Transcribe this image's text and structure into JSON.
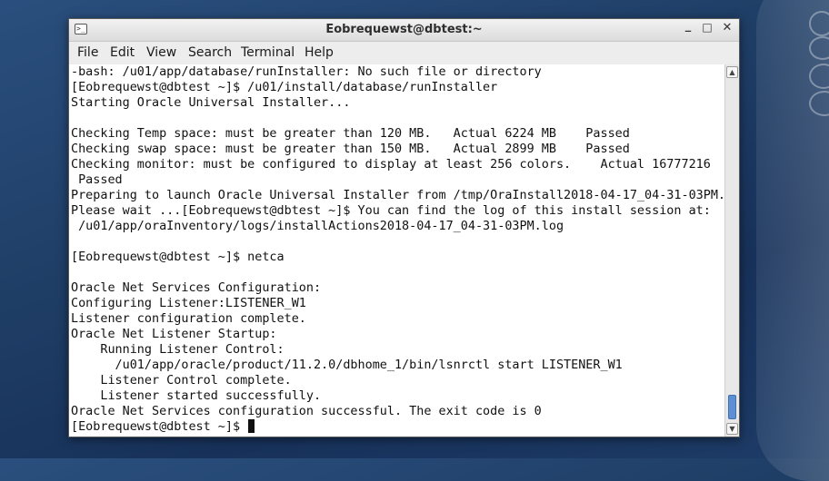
{
  "window": {
    "title": "Eobrequewst@dbtest:~",
    "minimize_glyph": "_",
    "maximize_glyph": "□",
    "close_glyph": "✕"
  },
  "menu": {
    "file": "File",
    "edit": "Edit",
    "view": "View",
    "search": "Search",
    "terminal": "Terminal",
    "help": "Help"
  },
  "terminal": {
    "lines": [
      "-bash: /u01/app/database/runInstaller: No such file or directory",
      "[Eobrequewst@dbtest ~]$ /u01/install/database/runInstaller",
      "Starting Oracle Universal Installer...",
      "",
      "Checking Temp space: must be greater than 120 MB.   Actual 6224 MB    Passed",
      "Checking swap space: must be greater than 150 MB.   Actual 2899 MB    Passed",
      "Checking monitor: must be configured to display at least 256 colors.    Actual 16777216",
      " Passed",
      "Preparing to launch Oracle Universal Installer from /tmp/OraInstall2018-04-17_04-31-03PM.",
      "Please wait ...[Eobrequewst@dbtest ~]$ You can find the log of this install session at:",
      " /u01/app/oraInventory/logs/installActions2018-04-17_04-31-03PM.log",
      "",
      "[Eobrequewst@dbtest ~]$ netca",
      "",
      "Oracle Net Services Configuration:",
      "Configuring Listener:LISTENER_W1",
      "Listener configuration complete.",
      "Oracle Net Listener Startup:",
      "    Running Listener Control:",
      "      /u01/app/oracle/product/11.2.0/dbhome_1/bin/lsnrctl start LISTENER_W1",
      "    Listener Control complete.",
      "    Listener started successfully.",
      "Oracle Net Services configuration successful. The exit code is 0",
      "[Eobrequewst@dbtest ~]$ "
    ]
  },
  "icons": {
    "title": "terminal-icon",
    "scroll_up": "chevron-up-icon",
    "scroll_down": "chevron-down-icon"
  }
}
